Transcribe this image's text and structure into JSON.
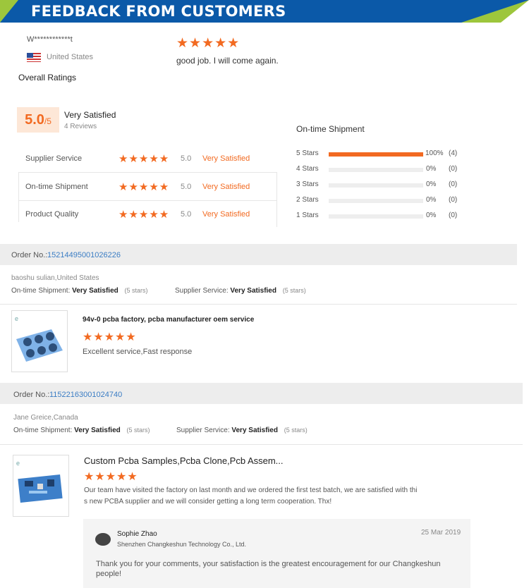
{
  "banner": {
    "title": "FEEDBACK FROM CUSTOMERS"
  },
  "top_review": {
    "name": "W************t",
    "country": "United States",
    "stars": 5,
    "text": "good job. I will come again."
  },
  "overall": {
    "heading": "Overall Ratings",
    "score": "5.0",
    "score_suffix": "/5",
    "label": "Very Satisfied",
    "reviews": "4 Reviews",
    "rows": [
      {
        "label": "Supplier Service",
        "value": "5.0",
        "text": "Very Satisfied"
      },
      {
        "label": "On-time Shipment",
        "value": "5.0",
        "text": "Very Satisfied"
      },
      {
        "label": "Product Quality",
        "value": "5.0",
        "text": "Very Satisfied"
      }
    ]
  },
  "shipment": {
    "heading": "On-time Shipment",
    "rows": [
      {
        "label": "5 Stars",
        "fraction": 1.0,
        "pct": "100%",
        "count": "(4)"
      },
      {
        "label": "4 Stars",
        "fraction": 0,
        "pct": "0%",
        "count": "(0)"
      },
      {
        "label": "3 Stars",
        "fraction": 0,
        "pct": "0%",
        "count": "(0)"
      },
      {
        "label": "2 Stars",
        "fraction": 0,
        "pct": "0%",
        "count": "(0)"
      },
      {
        "label": "1 Stars",
        "fraction": 0,
        "pct": "0%",
        "count": "(0)"
      }
    ]
  },
  "orders": [
    {
      "order_label": "Order No.:",
      "order_no": "15214495001026226",
      "buyer": "baoshu sulian,United States",
      "ship_label": "On-time Shipment:",
      "ship_value": "Very Satisfied",
      "ship_stars": "(5 stars)",
      "service_label": "Supplier Service:",
      "service_value": "Very Satisfied",
      "service_stars": "(5 stars)",
      "product_title": "94v-0 pcba factory, pcba manufacturer oem service",
      "comment": "Excellent service,Fast response"
    },
    {
      "order_label": "Order No.:",
      "order_no": "11522163001024740",
      "buyer": "Jane Greice,Canada",
      "ship_label": "On-time Shipment:",
      "ship_value": "Very Satisfied",
      "ship_stars": "(5 stars)",
      "service_label": "Supplier Service:",
      "service_value": "Very Satisfied",
      "service_stars": "(5 stars)",
      "product_title": "Custom Pcba Samples,Pcba Clone,Pcb Assem...",
      "comment_line1": "Our team have visited the factory on last month and we ordered the first test batch, we are satisfied with thi",
      "comment_line2": "s new PCBA supplier and we will consider getting a long term cooperation. Thx!"
    }
  ],
  "reply": {
    "name": "Sophie Zhao",
    "company": "Shenzhen Changkeshun Technology Co., Ltd.",
    "date": "25 Mar 2019",
    "text_line1": "Thank you for your comments, your satisfaction is the greatest encouragement for our Changkeshun",
    "text_line2": "people!"
  },
  "stars_glyph": "★★★★★",
  "icons": {
    "flag": "us-flag-icon",
    "avatar": "user-avatar-icon"
  }
}
